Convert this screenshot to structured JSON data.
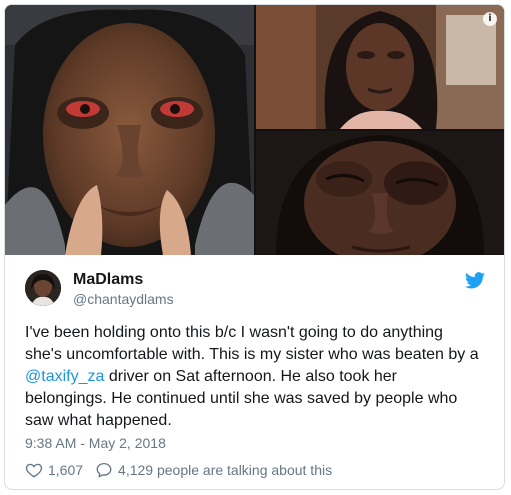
{
  "tweet": {
    "display_name": "MaDlams",
    "handle": "@chantaydlams",
    "text_lines": [
      "I've been holding onto this b/c I wasn't going to do anything",
      "she's uncomfortable with. This is my sister who was beaten by a",
      "driver on Sat afternoon. He also took her",
      "belongings. He continued until she was saved by people who",
      "saw what happened."
    ],
    "mention": "@taxify_za",
    "timestamp": "9:38 AM - May 2, 2018",
    "likes": "1,607",
    "conversation": "4,129 people are talking about this"
  },
  "icons": {
    "info": "info-icon",
    "bird": "twitter-bird-icon",
    "like": "heart-icon",
    "reply": "speech-bubble-icon"
  },
  "colors": {
    "link": "#1b95e0",
    "text": "#14171a",
    "muted": "#657786",
    "border": "#d6dde3"
  }
}
